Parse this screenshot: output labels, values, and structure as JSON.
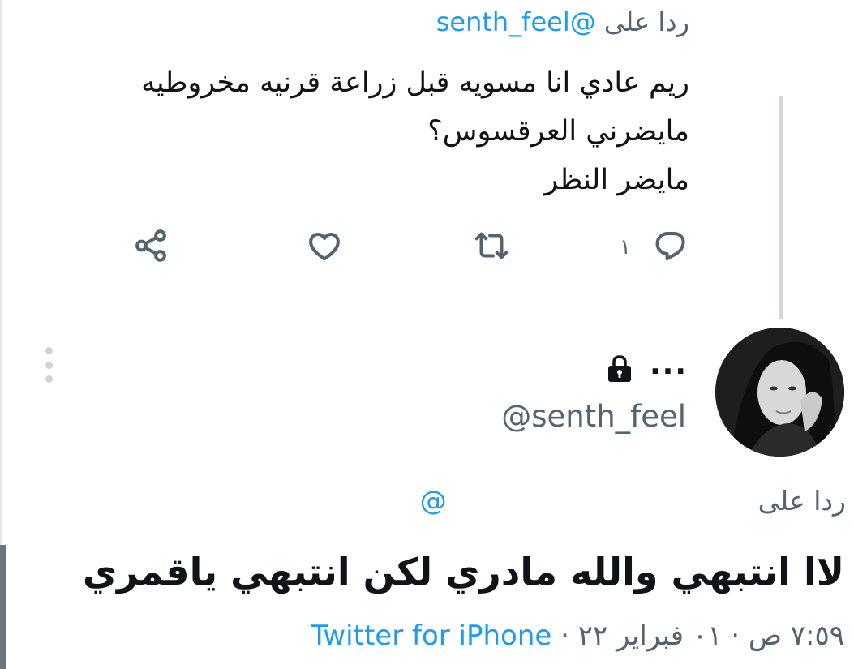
{
  "parent_tweet": {
    "replying_prefix": "ردا على",
    "replying_handle": "@senth_feel",
    "text_lines": [
      "ريم عادي انا مسويه قبل زراعة قرنيه مخروطيه",
      "مايضرني العرقسوس؟",
      "مايضر النظر"
    ],
    "reply_count": "١",
    "icons": [
      "reply-icon",
      "retweet-icon",
      "like-icon",
      "share-icon"
    ]
  },
  "main_tweet": {
    "handle": "@senth_feel",
    "more_dots": "...",
    "replying_prefix": "ردا على",
    "replying_handle": "@",
    "text": "لاا انتبهي والله مادري لكن انتبهي ياقمري",
    "time": "٧:٥٩ ص",
    "date": "٠١ فبراير ٢٢",
    "separator": "·",
    "source": "Twitter for iPhone",
    "icons": [
      "lock-icon",
      "avatar"
    ]
  },
  "colors": {
    "text": "#0f1419",
    "secondary": "#536471",
    "link": "#1d9bf0",
    "thread_line": "#cfd9de"
  }
}
